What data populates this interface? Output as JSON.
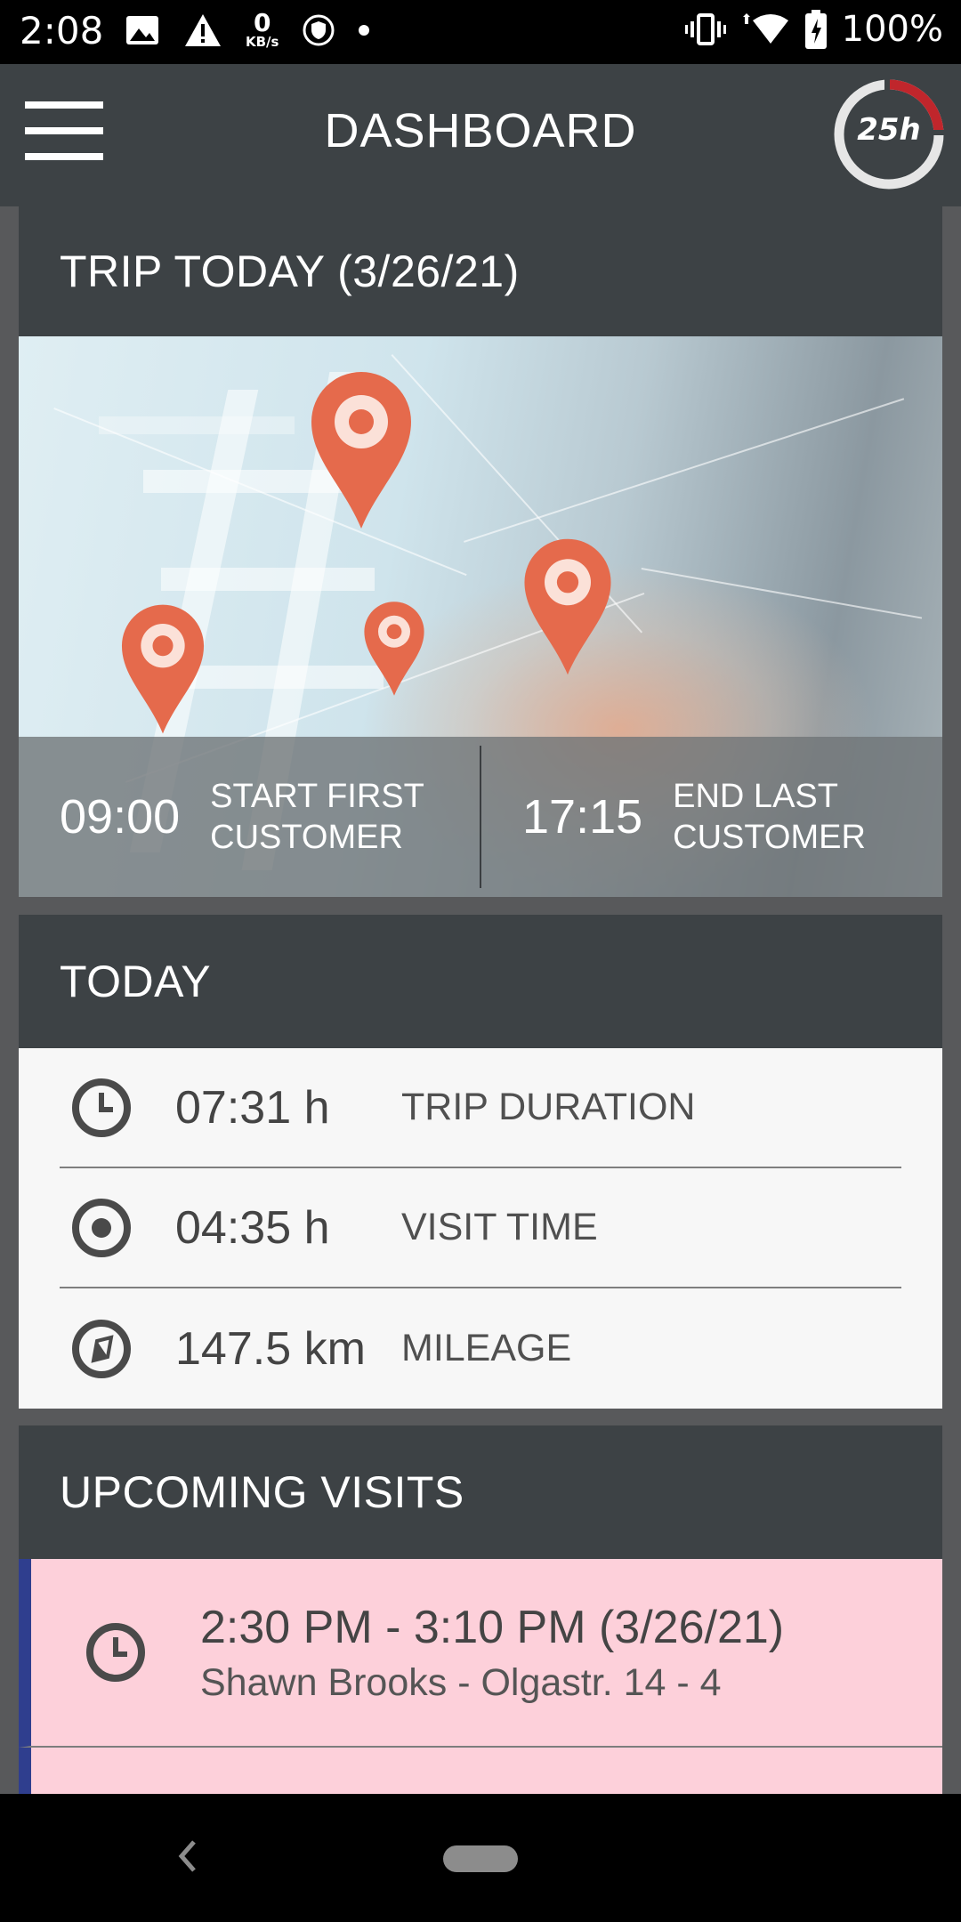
{
  "status_bar": {
    "time": "2:08",
    "net_speed_value": "0",
    "net_speed_unit": "KB/s",
    "battery": "100%"
  },
  "app_bar": {
    "title": "DASHBOARD",
    "timer_badge": "25h",
    "menu_icon": "hamburger-menu-icon"
  },
  "trip": {
    "header": "TRIP TODAY (3/26/21)",
    "start_time": "09:00",
    "start_label_line1": "START FIRST",
    "start_label_line2": "CUSTOMER",
    "end_time": "17:15",
    "end_label_line1": "END LAST",
    "end_label_line2": "CUSTOMER"
  },
  "today": {
    "header": "TODAY",
    "rows": [
      {
        "icon": "clock-icon",
        "value": "07:31 h",
        "label": "TRIP DURATION"
      },
      {
        "icon": "target-icon",
        "value": "04:35 h",
        "label": "VISIT TIME"
      },
      {
        "icon": "compass-icon",
        "value": "147.5 km",
        "label": "MILEAGE"
      }
    ]
  },
  "upcoming": {
    "header": "UPCOMING VISITS",
    "visits": [
      {
        "icon": "clock-icon",
        "time": "2:30 PM - 3:10 PM (3/26/21)",
        "detail": "Shawn Brooks - Olgastr. 14 - 4"
      }
    ]
  },
  "colors": {
    "app_bar": "#3d4245",
    "visit_highlight": "#fdd0da",
    "visit_accent": "#2f3e8e",
    "timer_ring_accent": "#c0262c"
  }
}
